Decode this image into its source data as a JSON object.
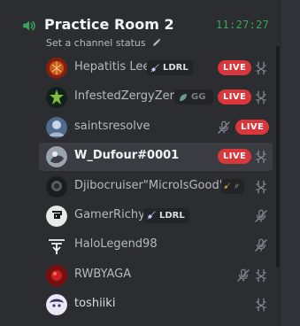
{
  "channel": {
    "name": "Practice Room 2",
    "status_placeholder": "Set a channel status",
    "clock": "11:27:27"
  },
  "live_label": "LIVE",
  "colors": {
    "live": "#da373c",
    "voice_green": "#3ba55d",
    "badge_bg": "#232428"
  },
  "users": [
    {
      "name": "Hepatitis Lee",
      "tag": "LDRL",
      "tag_icon": "sword-icon",
      "live": true,
      "icon": "streamer-mode-icon"
    },
    {
      "name": "InfestedZergyZerg",
      "tag": "GG",
      "tag_icon": "leaf-icon",
      "live": true,
      "icon": "streamer-mode-icon"
    },
    {
      "name": "saintsresolve",
      "live": true,
      "icon": "muted-mic-icon"
    },
    {
      "name": "W_Dufour#0001",
      "live": true,
      "icon": "streamer-mode-icon",
      "active": true
    },
    {
      "name": "Djibocruiser\"MicroIsGood\"",
      "tag_icon": "sword-icon",
      "icon": "muted-mic-icon",
      "icon2": "streamer-mode-icon"
    },
    {
      "name": "GamerRichy",
      "tag": "LDRL",
      "tag_icon": "sword-icon",
      "icon": "muted-mic-icon"
    },
    {
      "name": "HaloLegend98",
      "icon": "muted-mic-icon"
    },
    {
      "name": "RWBYAGA",
      "icon": "muted-mic-icon",
      "icon2": "streamer-mode-icon"
    },
    {
      "name": "toshiiki",
      "icon": "streamer-mode-icon"
    }
  ]
}
